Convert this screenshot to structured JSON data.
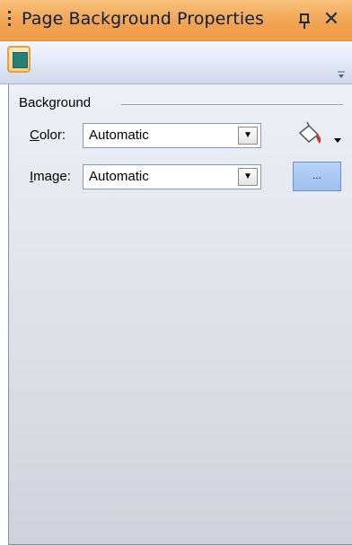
{
  "panel": {
    "title": "Page Background Properties",
    "pin_glyph": "ↀ",
    "close_glyph": "✕"
  },
  "toolbar": {
    "page_background_button_icon": "page-background-swatch-icon",
    "swatch_color": "#287d7d",
    "overflow_glyph": "▾"
  },
  "background_group": {
    "label": "Background",
    "color": {
      "label": "Color:",
      "value": "Automatic",
      "fill_button_icon": "paint-bucket-icon"
    },
    "image": {
      "label": "Image:",
      "value": "Automatic",
      "browse_label": "..."
    }
  },
  "colors": {
    "title_bar": "#f1a451",
    "toolbar": "#dfe6f4",
    "body": "#dfe1ea",
    "browse_button": "#9ebff0"
  }
}
